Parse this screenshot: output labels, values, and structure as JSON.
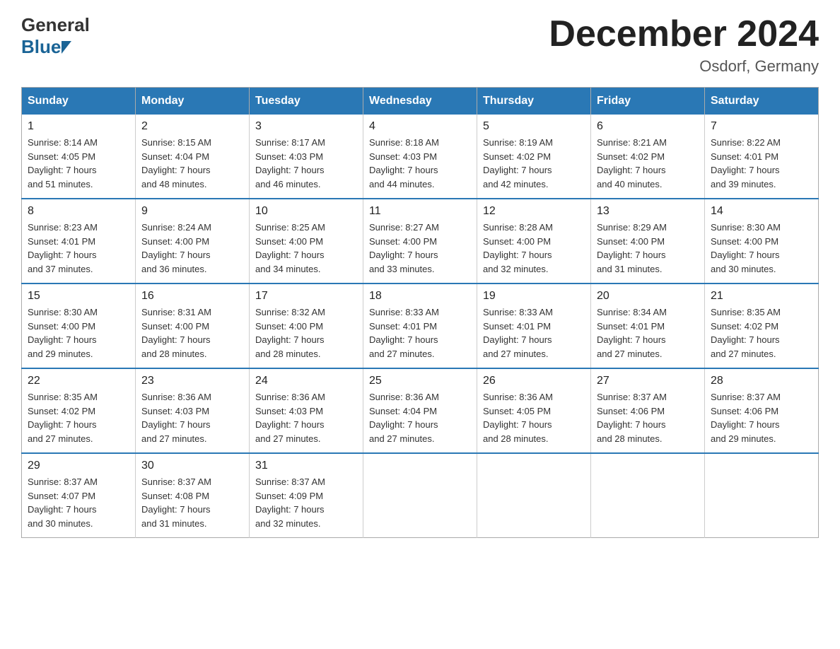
{
  "header": {
    "logo_general": "General",
    "logo_blue": "Blue",
    "title": "December 2024",
    "subtitle": "Osdorf, Germany"
  },
  "days_of_week": [
    "Sunday",
    "Monday",
    "Tuesday",
    "Wednesday",
    "Thursday",
    "Friday",
    "Saturday"
  ],
  "weeks": [
    [
      {
        "day": "1",
        "sunrise": "8:14 AM",
        "sunset": "4:05 PM",
        "daylight": "7 hours and 51 minutes."
      },
      {
        "day": "2",
        "sunrise": "8:15 AM",
        "sunset": "4:04 PM",
        "daylight": "7 hours and 48 minutes."
      },
      {
        "day": "3",
        "sunrise": "8:17 AM",
        "sunset": "4:03 PM",
        "daylight": "7 hours and 46 minutes."
      },
      {
        "day": "4",
        "sunrise": "8:18 AM",
        "sunset": "4:03 PM",
        "daylight": "7 hours and 44 minutes."
      },
      {
        "day": "5",
        "sunrise": "8:19 AM",
        "sunset": "4:02 PM",
        "daylight": "7 hours and 42 minutes."
      },
      {
        "day": "6",
        "sunrise": "8:21 AM",
        "sunset": "4:02 PM",
        "daylight": "7 hours and 40 minutes."
      },
      {
        "day": "7",
        "sunrise": "8:22 AM",
        "sunset": "4:01 PM",
        "daylight": "7 hours and 39 minutes."
      }
    ],
    [
      {
        "day": "8",
        "sunrise": "8:23 AM",
        "sunset": "4:01 PM",
        "daylight": "7 hours and 37 minutes."
      },
      {
        "day": "9",
        "sunrise": "8:24 AM",
        "sunset": "4:00 PM",
        "daylight": "7 hours and 36 minutes."
      },
      {
        "day": "10",
        "sunrise": "8:25 AM",
        "sunset": "4:00 PM",
        "daylight": "7 hours and 34 minutes."
      },
      {
        "day": "11",
        "sunrise": "8:27 AM",
        "sunset": "4:00 PM",
        "daylight": "7 hours and 33 minutes."
      },
      {
        "day": "12",
        "sunrise": "8:28 AM",
        "sunset": "4:00 PM",
        "daylight": "7 hours and 32 minutes."
      },
      {
        "day": "13",
        "sunrise": "8:29 AM",
        "sunset": "4:00 PM",
        "daylight": "7 hours and 31 minutes."
      },
      {
        "day": "14",
        "sunrise": "8:30 AM",
        "sunset": "4:00 PM",
        "daylight": "7 hours and 30 minutes."
      }
    ],
    [
      {
        "day": "15",
        "sunrise": "8:30 AM",
        "sunset": "4:00 PM",
        "daylight": "7 hours and 29 minutes."
      },
      {
        "day": "16",
        "sunrise": "8:31 AM",
        "sunset": "4:00 PM",
        "daylight": "7 hours and 28 minutes."
      },
      {
        "day": "17",
        "sunrise": "8:32 AM",
        "sunset": "4:00 PM",
        "daylight": "7 hours and 28 minutes."
      },
      {
        "day": "18",
        "sunrise": "8:33 AM",
        "sunset": "4:01 PM",
        "daylight": "7 hours and 27 minutes."
      },
      {
        "day": "19",
        "sunrise": "8:33 AM",
        "sunset": "4:01 PM",
        "daylight": "7 hours and 27 minutes."
      },
      {
        "day": "20",
        "sunrise": "8:34 AM",
        "sunset": "4:01 PM",
        "daylight": "7 hours and 27 minutes."
      },
      {
        "day": "21",
        "sunrise": "8:35 AM",
        "sunset": "4:02 PM",
        "daylight": "7 hours and 27 minutes."
      }
    ],
    [
      {
        "day": "22",
        "sunrise": "8:35 AM",
        "sunset": "4:02 PM",
        "daylight": "7 hours and 27 minutes."
      },
      {
        "day": "23",
        "sunrise": "8:36 AM",
        "sunset": "4:03 PM",
        "daylight": "7 hours and 27 minutes."
      },
      {
        "day": "24",
        "sunrise": "8:36 AM",
        "sunset": "4:03 PM",
        "daylight": "7 hours and 27 minutes."
      },
      {
        "day": "25",
        "sunrise": "8:36 AM",
        "sunset": "4:04 PM",
        "daylight": "7 hours and 27 minutes."
      },
      {
        "day": "26",
        "sunrise": "8:36 AM",
        "sunset": "4:05 PM",
        "daylight": "7 hours and 28 minutes."
      },
      {
        "day": "27",
        "sunrise": "8:37 AM",
        "sunset": "4:06 PM",
        "daylight": "7 hours and 28 minutes."
      },
      {
        "day": "28",
        "sunrise": "8:37 AM",
        "sunset": "4:06 PM",
        "daylight": "7 hours and 29 minutes."
      }
    ],
    [
      {
        "day": "29",
        "sunrise": "8:37 AM",
        "sunset": "4:07 PM",
        "daylight": "7 hours and 30 minutes."
      },
      {
        "day": "30",
        "sunrise": "8:37 AM",
        "sunset": "4:08 PM",
        "daylight": "7 hours and 31 minutes."
      },
      {
        "day": "31",
        "sunrise": "8:37 AM",
        "sunset": "4:09 PM",
        "daylight": "7 hours and 32 minutes."
      },
      null,
      null,
      null,
      null
    ]
  ],
  "labels": {
    "sunrise": "Sunrise:",
    "sunset": "Sunset:",
    "daylight": "Daylight:"
  }
}
